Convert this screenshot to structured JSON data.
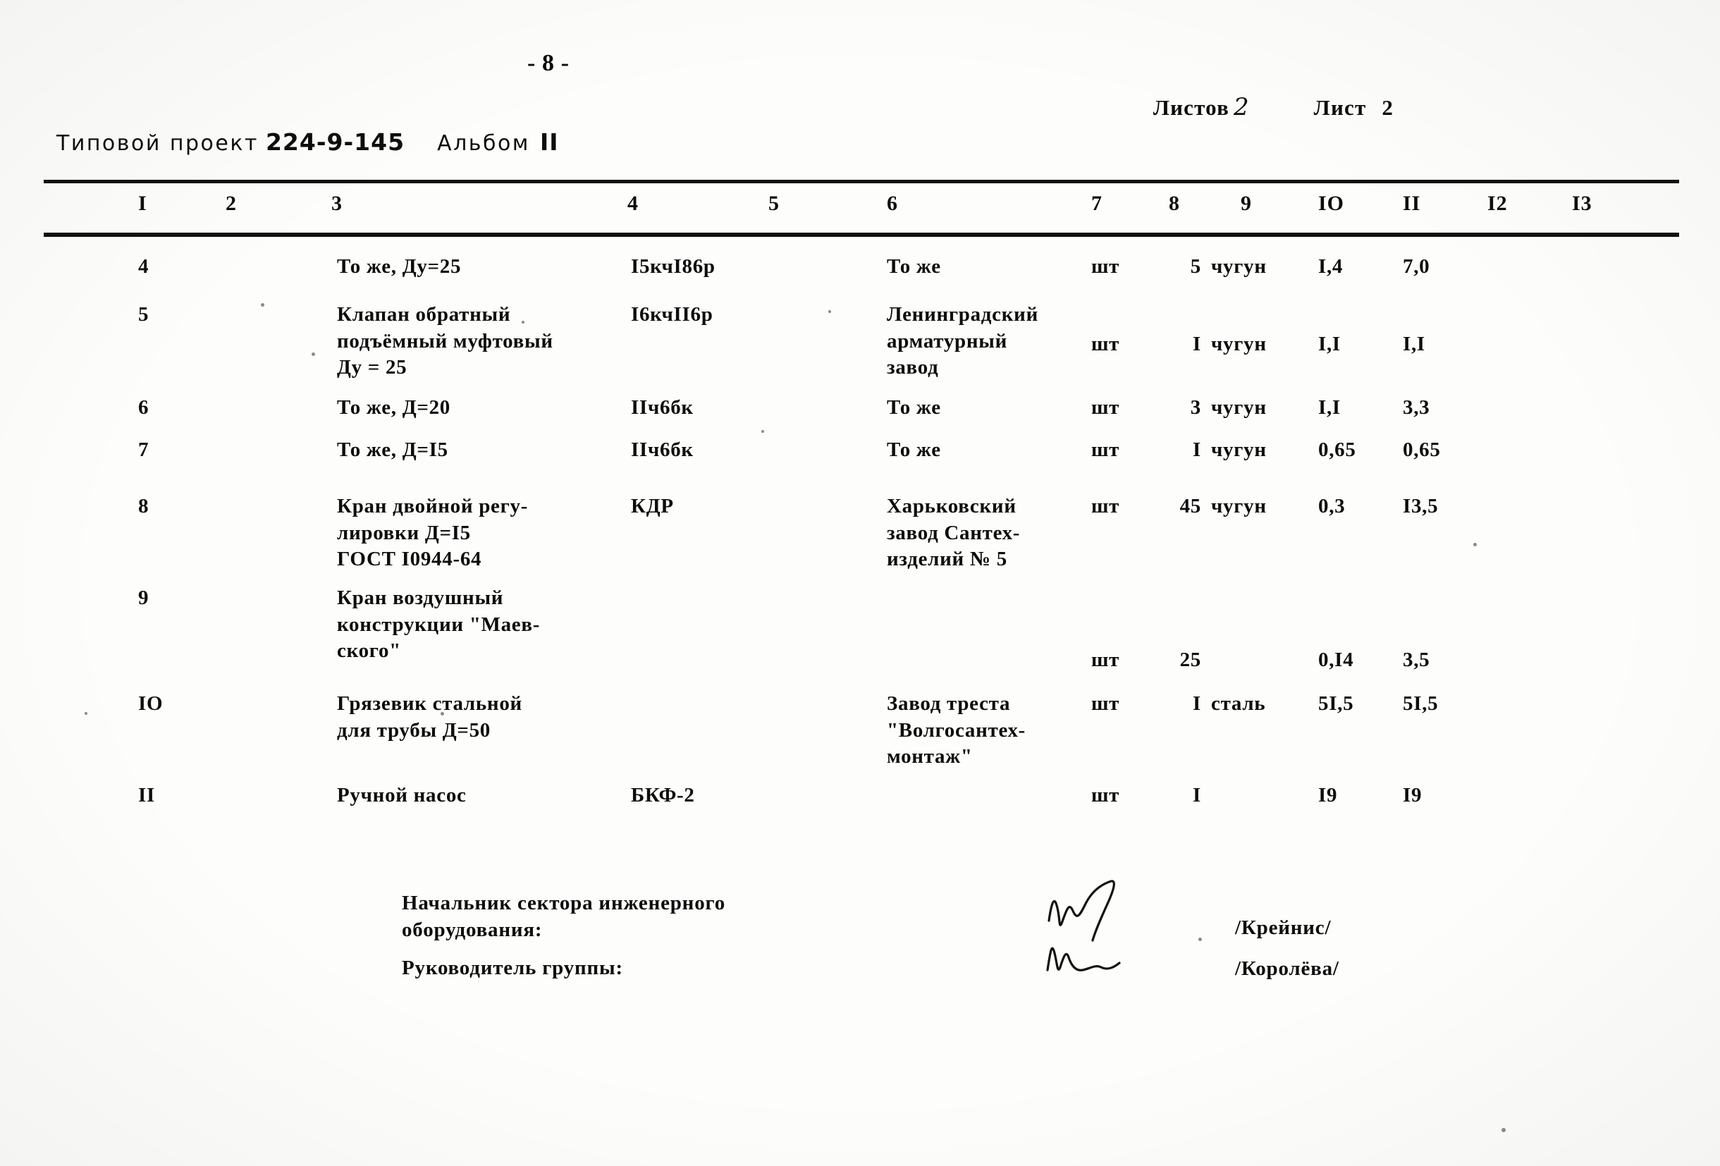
{
  "document": {
    "page_number": "- 8 -",
    "project_label": "Типовой проект",
    "project_code": "224-9-145",
    "album_label": "Альбом",
    "album_value": "II",
    "sheets_total_label": "Листов",
    "sheets_total_value": "2",
    "sheet_label": "Лист",
    "sheet_value": "2"
  },
  "table": {
    "column_numbers": [
      "I",
      "2",
      "3",
      "4",
      "5",
      "6",
      "7",
      "8",
      "9",
      "IO",
      "II",
      "I2",
      "I3"
    ],
    "rows": [
      {
        "num": "4",
        "name": "То же,  Ду=25",
        "type": "I5кчI86р",
        "supplier": "То же",
        "unit": "шт",
        "qty": "5",
        "material": "чугун",
        "weight_unit": "I,4",
        "weight_total": "7,0"
      },
      {
        "num": "5",
        "name": "Клапан обратный\nподъёмный муфтовый\nДу = 25",
        "type": "I6кчII6р",
        "supplier": "Ленинградский\nарматурный\nзавод",
        "unit": "шт",
        "qty": "I",
        "material": "чугун",
        "weight_unit": "I,I",
        "weight_total": "I,I"
      },
      {
        "num": "6",
        "name": "То же, Д=20",
        "type": "IIч6бк",
        "supplier": "То же",
        "unit": "шт",
        "qty": "3",
        "material": "чугун",
        "weight_unit": "I,I",
        "weight_total": "3,3"
      },
      {
        "num": "7",
        "name": "То же, Д=I5",
        "type": "IIч6бк",
        "supplier": "То же",
        "unit": "шт",
        "qty": "I",
        "material": "чугун",
        "weight_unit": "0,65",
        "weight_total": "0,65"
      },
      {
        "num": "8",
        "name": "Кран двойной регу-\nлировки Д=I5\nГОСТ I0944-64",
        "type": "КДР",
        "supplier": "Харьковский\nзавод Сантех-\nизделий № 5",
        "unit": "шт",
        "qty": "45",
        "material": "чугун",
        "weight_unit": "0,3",
        "weight_total": "I3,5"
      },
      {
        "num": "9",
        "name": "Кран воздушный\nконструкции \"Маев-\nского\"",
        "type": "",
        "supplier": "",
        "unit": "шт",
        "qty": "25",
        "material": "",
        "weight_unit": "0,I4",
        "weight_total": "3,5"
      },
      {
        "num": "IO",
        "name": "Грязевик стальной\nдля трубы Д=50",
        "type": "",
        "supplier": "Завод треста\n\"Волгосантех-\nмонтаж\"",
        "unit": "шт",
        "qty": "I",
        "material": "сталь",
        "weight_unit": "5I,5",
        "weight_total": "5I,5"
      },
      {
        "num": "II",
        "name": "Ручной насос",
        "type": "БКФ-2",
        "supplier": "",
        "unit": "шт",
        "qty": "I",
        "material": "",
        "weight_unit": "I9",
        "weight_total": "I9"
      }
    ]
  },
  "signatures": [
    {
      "role": "Начальник сектора инженерного\nоборудования:",
      "name": "/Крейнис/"
    },
    {
      "role": "Руководитель группы:",
      "name": "/Королёва/"
    }
  ],
  "colors": {
    "ink": "#0d0d0d",
    "paper": "#fdfdfb"
  }
}
